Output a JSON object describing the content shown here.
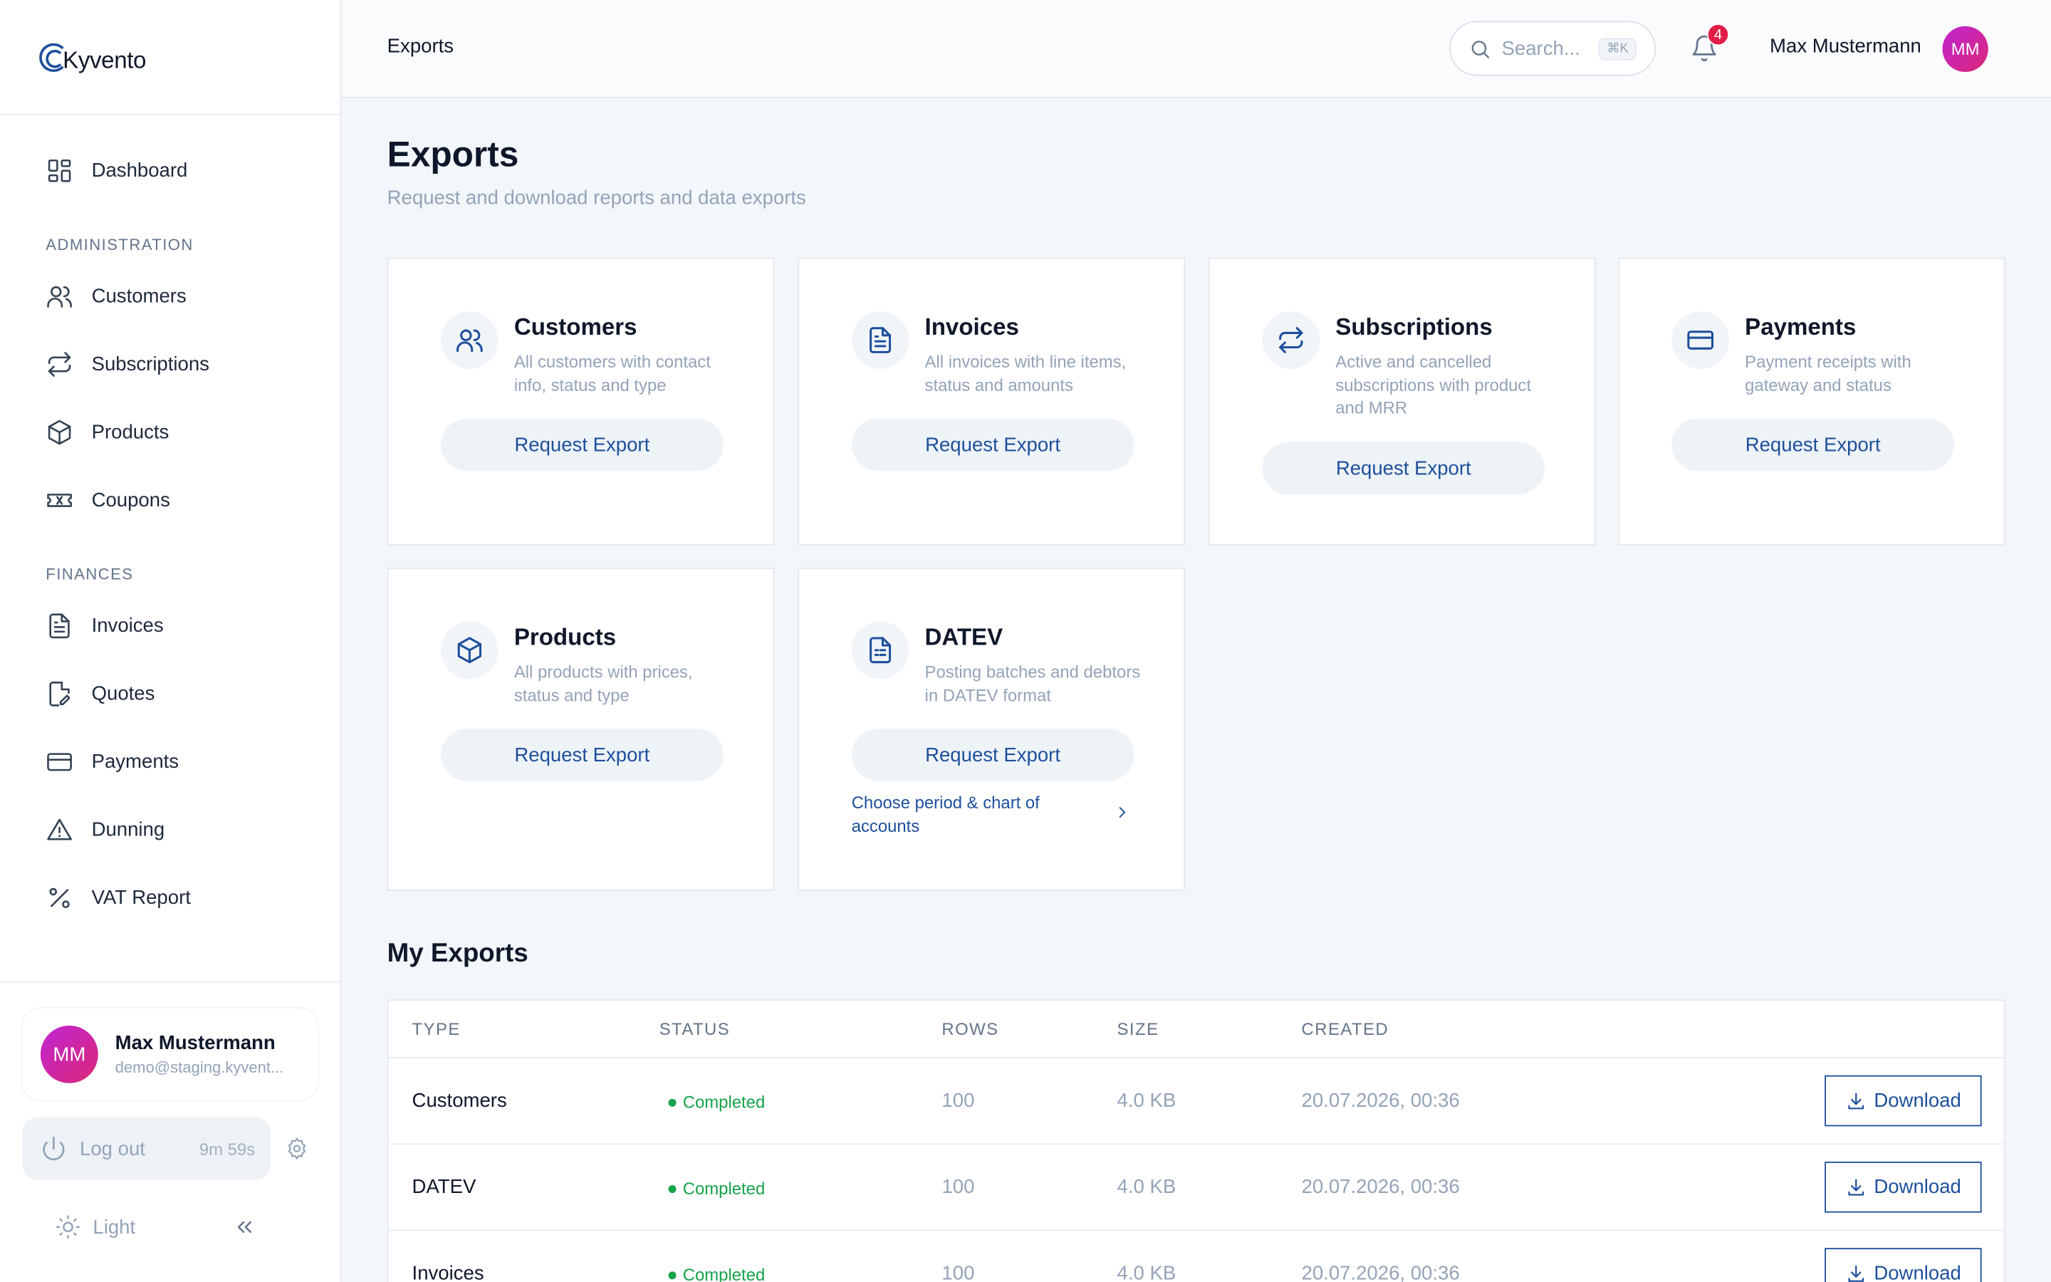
{
  "app": {
    "name": "Kyvento"
  },
  "sidebar": {
    "dashboard": "Dashboard",
    "section_admin": "ADMINISTRATION",
    "admin_items": [
      "Customers",
      "Subscriptions",
      "Products",
      "Coupons"
    ],
    "section_finance": "FINANCES",
    "finance_items": [
      "Invoices",
      "Quotes",
      "Payments",
      "Dunning",
      "VAT Report"
    ],
    "user": {
      "initials": "MM",
      "name": "Max Mustermann",
      "email": "demo@staging.kyvent..."
    },
    "logout_label": "Log out",
    "session_timer": "9m 59s",
    "theme_label": "Light"
  },
  "header": {
    "title": "Exports",
    "search_placeholder": "Search...",
    "search_shortcut": "⌘K",
    "notification_count": "4",
    "user_name": "Max Mustermann",
    "user_initials": "MM"
  },
  "page": {
    "title": "Exports",
    "subtitle": "Request and download reports and data exports"
  },
  "export_cards": [
    {
      "icon": "users-icon",
      "title": "Customers",
      "description": "All customers with contact info, status and type",
      "button": "Request Export"
    },
    {
      "icon": "document-icon",
      "title": "Invoices",
      "description": "All invoices with line items, status and amounts",
      "button": "Request Export"
    },
    {
      "icon": "repeat-icon",
      "title": "Subscriptions",
      "description": "Active and cancelled subscriptions with product and MRR",
      "button": "Request Export"
    },
    {
      "icon": "credit-card-icon",
      "title": "Payments",
      "description": "Payment receipts with gateway and status",
      "button": "Request Export"
    },
    {
      "icon": "package-icon",
      "title": "Products",
      "description": "All products with prices, status and type",
      "button": "Request Export"
    },
    {
      "icon": "spreadsheet-icon",
      "title": "DATEV",
      "description": "Posting batches and debtors in DATEV format",
      "button": "Request Export",
      "link": "Choose period & chart of accounts"
    }
  ],
  "my_exports": {
    "title": "My Exports",
    "columns": [
      "TYPE",
      "STATUS",
      "ROWS",
      "SIZE",
      "CREATED"
    ],
    "rows": [
      {
        "type": "Customers",
        "status": "Completed",
        "rows": "100",
        "size": "4.0 KB",
        "created": "20.07.2026, 00:36",
        "action": "Download"
      },
      {
        "type": "DATEV",
        "status": "Completed",
        "rows": "100",
        "size": "4.0 KB",
        "created": "20.07.2026, 00:36",
        "action": "Download"
      },
      {
        "type": "Invoices",
        "status": "Completed",
        "rows": "100",
        "size": "4.0 KB",
        "created": "20.07.2026, 00:36",
        "action": "Download"
      }
    ]
  },
  "colors": {
    "accent": "#1e4f9c",
    "success": "#16a34a",
    "badge": "#e11d48",
    "avatar": "#c026d3"
  }
}
